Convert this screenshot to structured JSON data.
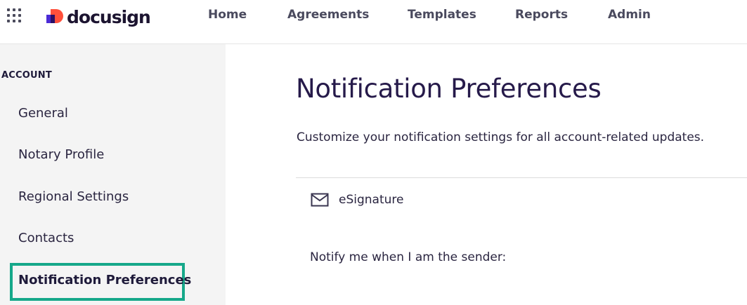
{
  "header": {
    "logo_text": "docusign",
    "nav": [
      {
        "label": "Home"
      },
      {
        "label": "Agreements"
      },
      {
        "label": "Templates"
      },
      {
        "label": "Reports"
      },
      {
        "label": "Admin"
      }
    ],
    "icons": [
      "apps-grid-icon",
      "docusign-logo-icon"
    ]
  },
  "sidebar": {
    "heading": "ACCOUNT",
    "items": [
      {
        "label": "General"
      },
      {
        "label": "Notary Profile"
      },
      {
        "label": "Regional Settings"
      },
      {
        "label": "Contacts"
      },
      {
        "label": "Notification Preferences",
        "active": true
      }
    ]
  },
  "main": {
    "title": "Notification Preferences",
    "description": "Customize your notification settings for all account-related updates.",
    "section": {
      "label": "eSignature",
      "icon": "mail-icon"
    },
    "notify_label": "Notify me when I am the sender:"
  },
  "colors": {
    "active_outline": "#16a88a",
    "sidebar_bg": "#f4f4f4",
    "logo_purple": "#4b2bd6",
    "logo_red": "#ff4f3b"
  }
}
